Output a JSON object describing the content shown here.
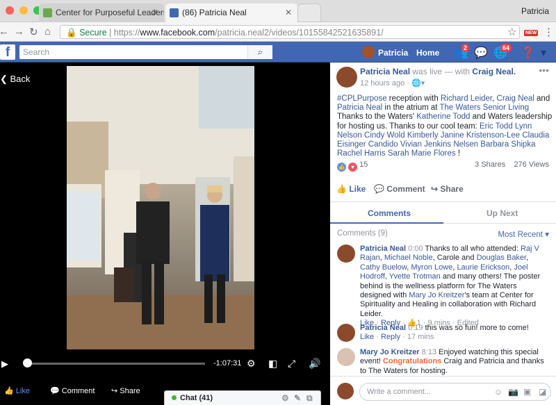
{
  "browser": {
    "tabs": [
      {
        "label": "Center for Purposeful Leadersh"
      },
      {
        "label": "(86) Patricia Neal"
      }
    ],
    "profile_name": "Patricia",
    "secure_label": "Secure",
    "url_scheme": "https://",
    "url_host": "www.facebook.com",
    "url_path": "/patricia.neal2/videos/10155842521635891/",
    "extension_badge": "NEW"
  },
  "fb_header": {
    "search_placeholder": "Search",
    "user_name": "Patricia",
    "home_label": "Home",
    "friend_requests_count": "2",
    "notifications_count": "64",
    "brand_color": "#4267b2"
  },
  "video": {
    "back_label": "Back",
    "time_remaining": "-1:07:31",
    "progress_fraction": 0.0,
    "actions": {
      "like": "Like",
      "comment": "Comment",
      "share": "Share"
    }
  },
  "chat": {
    "label": "Chat (41)"
  },
  "post": {
    "author": "Patricia Neal",
    "live_text": "was live — with",
    "with_name": "Craig Neal.",
    "time": "12 hours ago ·",
    "body_parts": [
      {
        "t": "#CPLPurpose",
        "link": true
      },
      {
        "t": " reception with ",
        "link": false
      },
      {
        "t": "Richard Leider",
        "link": true
      },
      {
        "t": ", ",
        "link": false
      },
      {
        "t": "Craig Neal",
        "link": true
      },
      {
        "t": " and ",
        "link": false
      },
      {
        "t": "Patricia Neal",
        "link": true
      },
      {
        "t": " in the atrium at ",
        "link": false
      },
      {
        "t": "The Waters Senior Living",
        "link": true
      },
      {
        "t": " Thanks to the Waters' ",
        "link": false
      },
      {
        "t": "Katherine Todd",
        "link": true
      },
      {
        "t": " and Waters leadership for hosting us. Thanks to our cool team: ",
        "link": false
      },
      {
        "t": "Eric Todd",
        "link": true
      },
      {
        "t": " ",
        "link": false
      },
      {
        "t": "Lynn Nelson",
        "link": true
      },
      {
        "t": " ",
        "link": false
      },
      {
        "t": "Cindy Wold",
        "link": true
      },
      {
        "t": " ",
        "link": false
      },
      {
        "t": "Kimberly Janine Kristenson-Lee",
        "link": true
      },
      {
        "t": " ",
        "link": false
      },
      {
        "t": "Claudia Eisinger",
        "link": true
      },
      {
        "t": " ",
        "link": false
      },
      {
        "t": "Candido Vivian Jenkins",
        "link": true
      },
      {
        "t": " ",
        "link": false
      },
      {
        "t": "Nelsen Barbara Shipka",
        "link": true
      },
      {
        "t": " ",
        "link": false
      },
      {
        "t": "Rachel Harris",
        "link": true
      },
      {
        "t": " ",
        "link": false
      },
      {
        "t": "Sarah Marie Flores",
        "link": true
      },
      {
        "t": " !",
        "link": false
      }
    ],
    "reaction_count": "15",
    "shares": "3 Shares",
    "views": "276 Views",
    "actions": {
      "like": "Like",
      "comment": "Comment",
      "share": "Share"
    }
  },
  "side_tabs": {
    "active": "Comments",
    "inactive": "Up Next"
  },
  "comments_header": {
    "count_label": "Comments (9)",
    "sort_label": "Most Recent"
  },
  "comments": [
    {
      "author": "Patricia Neal",
      "timecode": "0:00",
      "parts": [
        {
          "t": "Thanks to all who attended: ",
          "link": false
        },
        {
          "t": "Raj V Rajan",
          "link": true
        },
        {
          "t": ", ",
          "link": false
        },
        {
          "t": "Michael Noble",
          "link": true
        },
        {
          "t": ", Carole and ",
          "link": false
        },
        {
          "t": "Douglas Baker",
          "link": true
        },
        {
          "t": ", ",
          "link": false
        },
        {
          "t": "Cathy Buelow",
          "link": true
        },
        {
          "t": ", ",
          "link": false
        },
        {
          "t": "Myron Lowe",
          "link": true
        },
        {
          "t": ", ",
          "link": false
        },
        {
          "t": "Laurie Erickson",
          "link": true
        },
        {
          "t": ", ",
          "link": false
        },
        {
          "t": "Joel Hodroff",
          "link": true
        },
        {
          "t": ", ",
          "link": false
        },
        {
          "t": "Yvette Trotman",
          "link": true
        },
        {
          "t": " and many others! The poster behind is the wellness platform for The Waters designed with ",
          "link": false
        },
        {
          "t": "Mary Jo Kreitzer",
          "link": true
        },
        {
          "t": "'s team at Center for Spirituality and Healing in collaboration with Richard Leider.",
          "link": false
        }
      ],
      "like": "Like",
      "reply": "Reply",
      "likes": "1",
      "time": "9 mins",
      "edited": "Edited"
    },
    {
      "author": "Patricia Neal",
      "timecode": "0:19",
      "parts": [
        {
          "t": "this was so fun! more to come!",
          "link": false
        }
      ],
      "like": "Like",
      "reply": "Reply",
      "time": "17 mins"
    },
    {
      "author": "Mary Jo Kreitzer",
      "timecode": "8:13",
      "parts": [
        {
          "t": "Enjoyed watching this special event! ",
          "link": false
        },
        {
          "t": "Congratulations",
          "link": false,
          "highlight": true
        },
        {
          "t": " Craig and Patricia and thanks to The Waters for hosting.",
          "link": false
        }
      ]
    }
  ],
  "compose": {
    "placeholder": "Write a comment..."
  }
}
